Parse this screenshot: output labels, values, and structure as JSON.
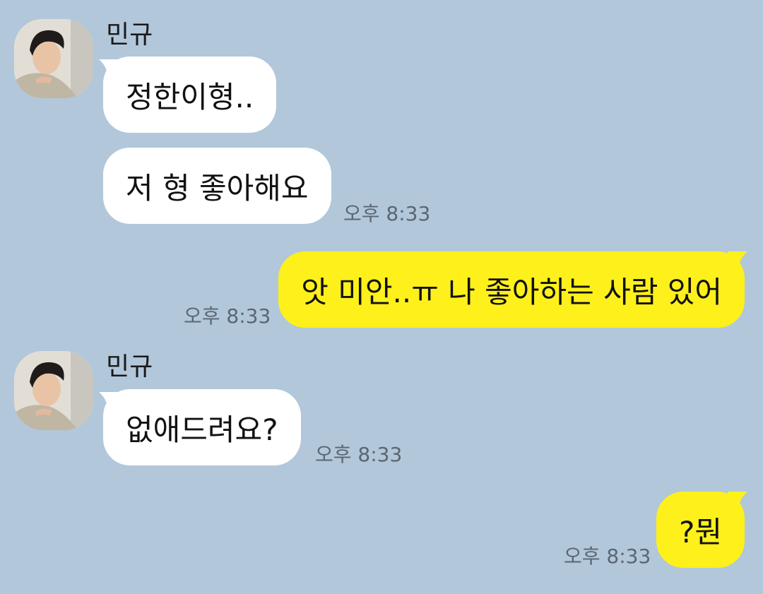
{
  "colors": {
    "background": "#b2c7da",
    "incoming_bubble": "#ffffff",
    "outgoing_bubble": "#fef01b"
  },
  "messages": [
    {
      "sender": "민규",
      "text": "정한이형.."
    },
    {
      "text": "저 형 좋아해요",
      "time": "오후 8:33"
    },
    {
      "text": "앗 미안..ㅠ 나 좋아하는 사람 있어",
      "time": "오후 8:33"
    },
    {
      "sender": "민규",
      "text": "없애드려요?",
      "time": "오후 8:33"
    },
    {
      "text": "?뭔",
      "time": "오후 8:33"
    }
  ]
}
